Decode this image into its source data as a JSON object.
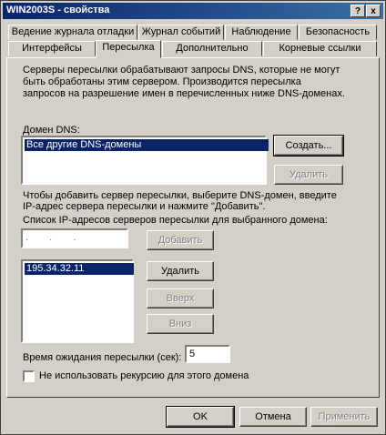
{
  "window": {
    "title": "WIN2003S - свойства",
    "help_btn": "?",
    "close_btn": "x"
  },
  "tabs_row1": [
    "Ведение журнала отладки",
    "Журнал событий",
    "Наблюдение",
    "Безопасность"
  ],
  "tabs_row2": [
    "Интерфейсы",
    "Пересылка",
    "Дополнительно",
    "Корневые ссылки"
  ],
  "active_tab": "Пересылка",
  "intro_text": [
    "Серверы пересылки обрабатывают запросы DNS, которые не могут",
    "быть обработаны этим сервером. Производится пересылка",
    "запросов на разрешение имен в перечисленных ниже DNS-доменах."
  ],
  "dns_domain_label": "Домен DNS:",
  "dns_domains": [
    "Все другие DNS-домены"
  ],
  "buttons": {
    "create": "Создать...",
    "remove_domain": "Удалить",
    "add": "Добавить",
    "remove_ip": "Удалить",
    "up": "Вверх",
    "down": "Вниз",
    "ok": "OK",
    "cancel": "Отмена",
    "apply": "Применить"
  },
  "instructions": [
    "Чтобы добавить сервер пересылки, выберите DNS-домен, введите",
    "IP-адрес сервера пересылки и нажмите \"Добавить\"."
  ],
  "ip_list_label": "Список IP-адресов серверов пересылки для выбранного домена:",
  "ip_input_placeholder": ". . .",
  "ip_list": [
    "195.34.32.11"
  ],
  "timeout_label": "Время ожидания пересылки (сек):",
  "timeout_value": "5",
  "no_recursion_label": "Не использовать рекурсию для этого домена",
  "no_recursion_checked": false
}
